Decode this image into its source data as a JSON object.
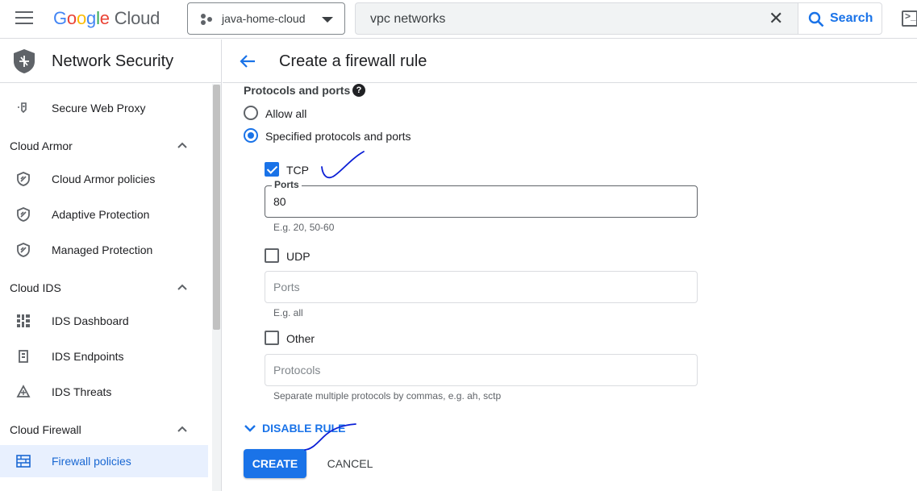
{
  "topbar": {
    "logo_letters": [
      "G",
      "o",
      "o",
      "g",
      "l",
      "e"
    ],
    "logo_product": "Cloud",
    "project_name": "java-home-cloud",
    "search_value": "vpc networks",
    "search_button": "Search",
    "icons": [
      "menu-icon",
      "project-icon",
      "chevron-down-icon",
      "close-icon",
      "search-icon",
      "terminal-icon"
    ]
  },
  "sidebar": {
    "title": "Network Security",
    "items": [
      {
        "type": "item",
        "label": "Secure Web Proxy",
        "icon": "proxy-icon"
      },
      {
        "type": "section",
        "label": "Cloud Armor",
        "expanded": true
      },
      {
        "type": "item",
        "label": "Cloud Armor policies",
        "icon": "shield-icon"
      },
      {
        "type": "item",
        "label": "Adaptive Protection",
        "icon": "shield-icon"
      },
      {
        "type": "item",
        "label": "Managed Protection",
        "icon": "shield-icon"
      },
      {
        "type": "section",
        "label": "Cloud IDS",
        "expanded": true
      },
      {
        "type": "item",
        "label": "IDS Dashboard",
        "icon": "dashboard-icon"
      },
      {
        "type": "item",
        "label": "IDS Endpoints",
        "icon": "endpoint-icon"
      },
      {
        "type": "item",
        "label": "IDS Threats",
        "icon": "threat-icon"
      },
      {
        "type": "section",
        "label": "Cloud Firewall",
        "expanded": true
      },
      {
        "type": "item",
        "label": "Firewall policies",
        "icon": "firewall-icon",
        "active": true
      }
    ]
  },
  "main": {
    "title": "Create a firewall rule",
    "protocols_label": "Protocols and ports",
    "help_glyph": "?",
    "radio_allow_all": "Allow all",
    "radio_specified": "Specified protocols and ports",
    "radio_selected": "specified",
    "tcp": {
      "label": "TCP",
      "checked": true,
      "field_label": "Ports",
      "value": "80",
      "hint": "E.g. 20, 50-60"
    },
    "udp": {
      "label": "UDP",
      "checked": false,
      "placeholder": "Ports",
      "hint": "E.g. all"
    },
    "other": {
      "label": "Other",
      "checked": false,
      "placeholder": "Protocols",
      "hint": "Separate multiple protocols by commas, e.g. ah, sctp"
    },
    "disable_rule": "DISABLE RULE",
    "create_button": "CREATE",
    "cancel_button": "CANCEL"
  },
  "colors": {
    "accent": "#1a73e8",
    "active_nav_bg": "#e8f0fe",
    "annotation_ink": "#0b1fd6"
  }
}
